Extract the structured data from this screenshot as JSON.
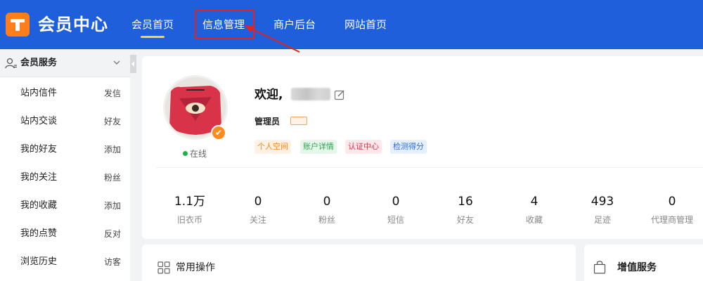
{
  "header": {
    "brand": "会员中心",
    "nav": [
      {
        "label": "会员首页",
        "active": true
      },
      {
        "label": "信息管理",
        "highlighted": true
      },
      {
        "label": "商户后台"
      },
      {
        "label": "网站首页"
      }
    ],
    "colors": {
      "background": "#1f5fdc",
      "logo": "#ff7e1b",
      "active_underline": "#ffd33a",
      "highlight_box": "#e02424"
    }
  },
  "sidebar": {
    "section_title": "会员服务",
    "items": [
      {
        "label": "站内信件",
        "action": "发信"
      },
      {
        "label": "站内交谈",
        "action": "好友"
      },
      {
        "label": "我的好友",
        "action": "添加"
      },
      {
        "label": "我的关注",
        "action": "粉丝"
      },
      {
        "label": "我的收藏",
        "action": "添加"
      },
      {
        "label": "我的点赞",
        "action": "反对"
      },
      {
        "label": "浏览历史",
        "action": "访客"
      }
    ]
  },
  "profile": {
    "welcome": "欢迎,",
    "status": "在线",
    "role": "管理员",
    "tags": [
      "个人空间",
      "账户详情",
      "认证中心",
      "检测得分"
    ]
  },
  "stats": [
    {
      "value": "1.1万",
      "label": "旧衣币"
    },
    {
      "value": "0",
      "label": "关注"
    },
    {
      "value": "0",
      "label": "粉丝"
    },
    {
      "value": "0",
      "label": "短信"
    },
    {
      "value": "16",
      "label": "好友"
    },
    {
      "value": "4",
      "label": "收藏"
    },
    {
      "value": "493",
      "label": "足迹"
    },
    {
      "value": "0",
      "label": "代理商管理"
    }
  ],
  "panels": {
    "common_ops": "常用操作",
    "value_added": "增值服务"
  }
}
